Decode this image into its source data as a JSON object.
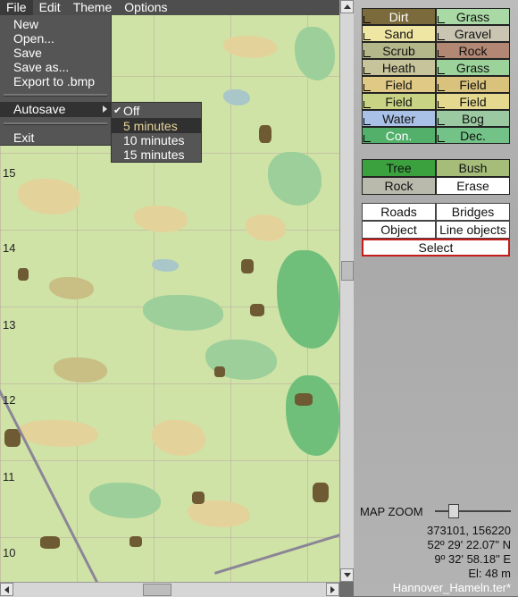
{
  "menubar": {
    "items": [
      "File",
      "Edit",
      "Theme",
      "Options"
    ]
  },
  "file_menu": {
    "items": [
      "New",
      "Open...",
      "Save",
      "Save as...",
      "Export to .bmp"
    ],
    "autosave": "Autosave",
    "exit": "Exit"
  },
  "autosave_menu": {
    "items": [
      "Off",
      "5 minutes",
      "10 minutes",
      "15 minutes"
    ],
    "checked": "Off",
    "highlighted": "5 minutes"
  },
  "map": {
    "grid_labels": [
      "15",
      "14",
      "13",
      "12",
      "11",
      "10"
    ]
  },
  "terrain": [
    {
      "label": "Dirt",
      "color": "#7a6a3c"
    },
    {
      "label": "Grass",
      "color": "#a9d9a4"
    },
    {
      "label": "Sand",
      "color": "#efe6a4"
    },
    {
      "label": "Gravel",
      "color": "#c9c5b2"
    },
    {
      "label": "Scrub",
      "color": "#b3b78a"
    },
    {
      "label": "Rock",
      "color": "#b28774"
    },
    {
      "label": "Heath",
      "color": "#c7c49b"
    },
    {
      "label": "Grass",
      "color": "#9bd39a"
    },
    {
      "label": "Field",
      "color": "#dfc985"
    },
    {
      "label": "Field",
      "color": "#d9c27c"
    },
    {
      "label": "Field",
      "color": "#c8d384"
    },
    {
      "label": "Field",
      "color": "#e4d98e"
    },
    {
      "label": "Water",
      "color": "#a9c1e6"
    },
    {
      "label": "Bog",
      "color": "#9bcaa2"
    },
    {
      "label": "Con.",
      "color": "#52b06a"
    },
    {
      "label": "Dec.",
      "color": "#73c388"
    }
  ],
  "brushes": [
    {
      "label": "Tree",
      "color": "#3aa13e"
    },
    {
      "label": "Bush",
      "color": "#a6bd7a"
    },
    {
      "label": "Rock",
      "color": "#b9b9ac"
    },
    {
      "label": "Erase",
      "color": "#ffffff"
    }
  ],
  "objects": [
    "Roads",
    "Bridges",
    "Object",
    "Line objects"
  ],
  "select_label": "Select",
  "zoom_label": "MAP ZOOM",
  "zoom_level": 0.23,
  "readout": {
    "coords": "373101, 156220",
    "lat": "52º 29' 22.07\" N",
    "lon": "9º 32' 58.18\" E",
    "elevation": "El: 48 m",
    "filename": "Hannover_Hameln.ter*"
  }
}
